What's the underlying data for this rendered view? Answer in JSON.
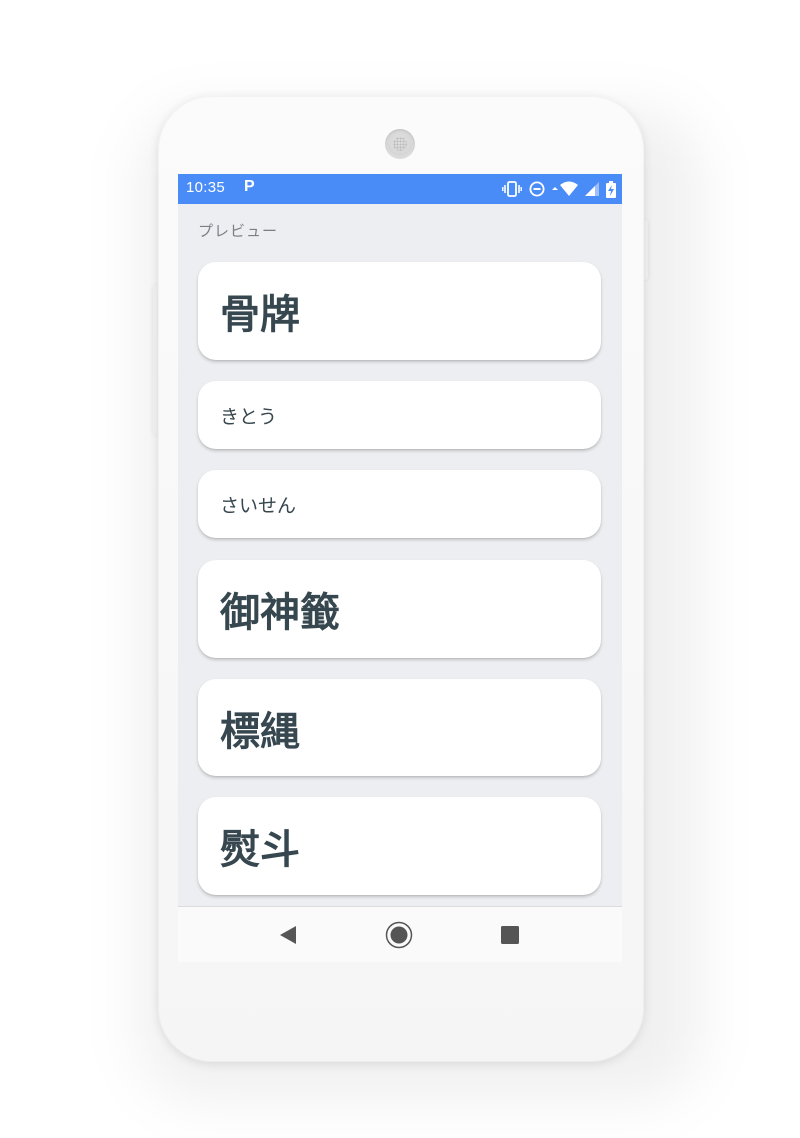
{
  "status_bar": {
    "time": "10:35",
    "app_icon_letter": "P",
    "background_color": "#4a8cf7",
    "icons": [
      "vibrate-icon",
      "do-not-disturb-icon",
      "wifi-icon",
      "cellular-signal-icon",
      "battery-charging-icon"
    ]
  },
  "main": {
    "section_label": "プレビュー",
    "cards": [
      {
        "text": "骨牌",
        "size": "large"
      },
      {
        "text": "きとう",
        "size": "small"
      },
      {
        "text": "さいせん",
        "size": "small"
      },
      {
        "text": "御神籤",
        "size": "large"
      },
      {
        "text": "標縄",
        "size": "large"
      },
      {
        "text": "熨斗",
        "size": "large"
      }
    ]
  },
  "nav_bar": {
    "buttons": [
      "back-icon",
      "home-icon",
      "recents-icon"
    ]
  },
  "colors": {
    "screen_background": "#eceef1",
    "card_text": "#37474f",
    "label_text": "#7b7f84",
    "nav_icon": "#555555"
  }
}
